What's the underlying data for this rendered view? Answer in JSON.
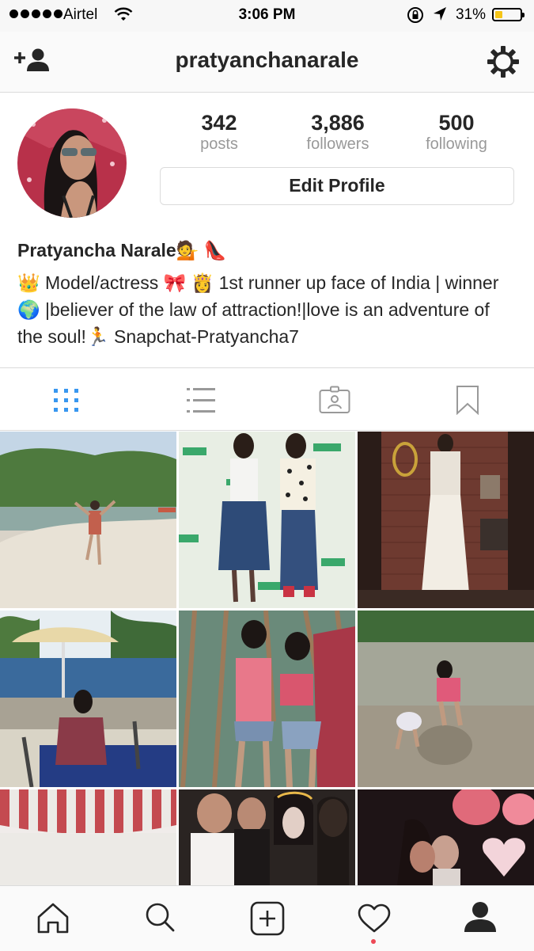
{
  "status_bar": {
    "carrier": "Airtel",
    "time": "3:06 PM",
    "battery_percent": "31%",
    "battery_level": 0.31
  },
  "nav": {
    "username": "pratyanchanarale",
    "icons": [
      "add-user-icon",
      "gear-icon"
    ]
  },
  "profile": {
    "stats": [
      {
        "value": "342",
        "label": "posts"
      },
      {
        "value": "3,886",
        "label": "followers"
      },
      {
        "value": "500",
        "label": "following"
      }
    ],
    "edit_button": "Edit Profile",
    "display_name": "Pratyancha Narale",
    "name_emojis": "💁 👠",
    "bio": "👑 Model/actress 🎀 👸 1st runner up face of India | winner🌍 |believer of the law of attraction!|love is an adventure of the soul!🏃 Snapchat-Pratyancha7"
  },
  "view_tabs": [
    "grid-icon",
    "list-icon",
    "tagged-icon",
    "bookmark-icon"
  ],
  "active_tab": "grid",
  "colors": {
    "accent": "#3897f0",
    "notification": "#ed4956",
    "battery": "#f5c518"
  },
  "bottom_nav": [
    "home-icon",
    "search-icon",
    "add-post-icon",
    "heart-icon",
    "profile-icon"
  ]
}
